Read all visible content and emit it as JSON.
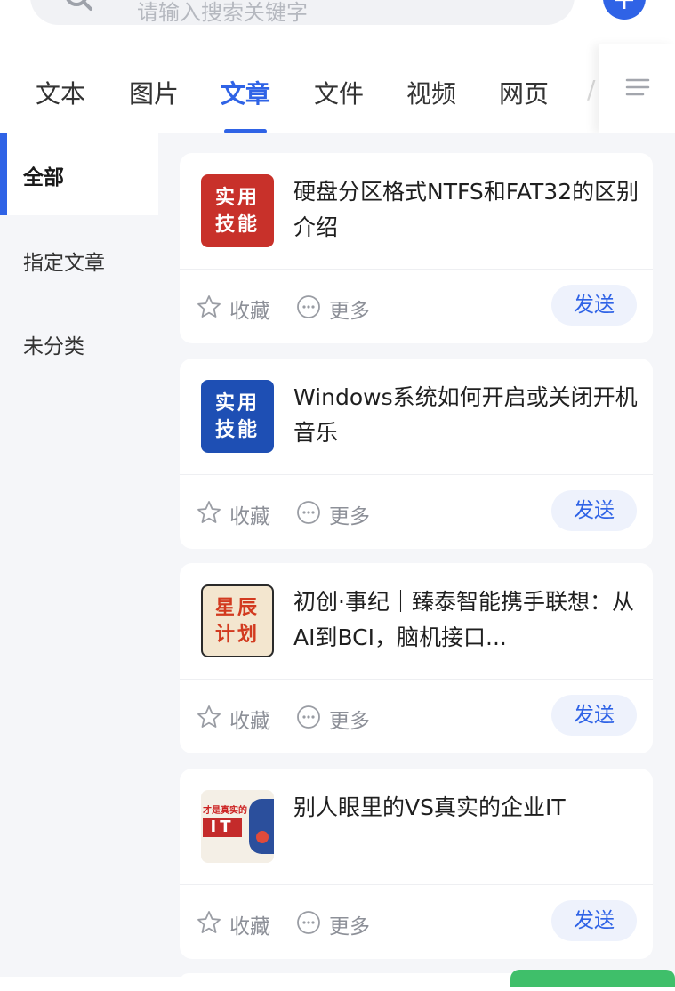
{
  "search": {
    "placeholder": "请输入搜索关键字",
    "add_label": "+"
  },
  "tabs": [
    {
      "label": "文本",
      "active": false
    },
    {
      "label": "图片",
      "active": false
    },
    {
      "label": "文章",
      "active": true
    },
    {
      "label": "文件",
      "active": false
    },
    {
      "label": "视频",
      "active": false
    },
    {
      "label": "网页",
      "active": false
    }
  ],
  "tab_overflow_hint": "/",
  "sidebar": {
    "items": [
      {
        "label": "全部",
        "active": true
      },
      {
        "label": "指定文章",
        "active": false
      },
      {
        "label": "未分类",
        "active": false
      }
    ]
  },
  "articles": [
    {
      "title": "硬盘分区格式NTFS和FAT32的区别介绍",
      "thumb_text_1": "实用",
      "thumb_text_2": "技能",
      "thumb_bg": "#c8312a"
    },
    {
      "title": "Windows系统如何开启或关闭开机音乐",
      "thumb_text_1": "实用",
      "thumb_text_2": "技能",
      "thumb_bg": "#1e4fb4"
    },
    {
      "title": "初创·事纪｜臻泰智能携手联想：从AI到BCI，脑机接口...",
      "thumb_text_1": "星辰",
      "thumb_text_2": "计划",
      "thumb_bg": "#f3e6cf"
    },
    {
      "title": "别人眼里的VS真实的企业IT",
      "thumb_text_1": "才是真实的",
      "thumb_text_2": "IT",
      "thumb_bg": "#f4efe6"
    }
  ],
  "actions": {
    "favorite_label": "收藏",
    "more_label": "更多",
    "send_label": "发送"
  },
  "colors": {
    "accent": "#2f63e6",
    "page_bg": "#f5f6f9"
  }
}
